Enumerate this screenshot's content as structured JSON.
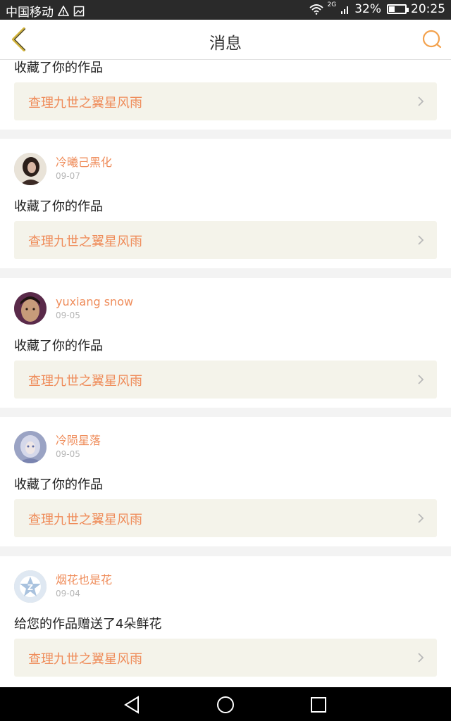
{
  "status_bar": {
    "carrier": "中国移动",
    "network": "2G",
    "battery": "32%",
    "time": "20:25",
    "battery_level": 0.32
  },
  "nav": {
    "title": "消息",
    "back_icon": "chevron-left-icon",
    "search_icon": "search-icon"
  },
  "colors": {
    "accent": "#ef8c5a",
    "back_arrow": "#d4b53a"
  },
  "messages": [
    {
      "action": "收藏了你的作品",
      "work_title": "查理九世之翼星风雨"
    },
    {
      "user": "冷曦己黑化",
      "date": "09-07",
      "action": "收藏了你的作品",
      "work_title": "查理九世之翼星风雨"
    },
    {
      "user": "yuxiang snow",
      "date": "09-05",
      "action": "收藏了你的作品",
      "work_title": "查理九世之翼星风雨"
    },
    {
      "user": "冷陨星落",
      "date": "09-05",
      "action": "收藏了你的作品",
      "work_title": "查理九世之翼星风雨"
    },
    {
      "user": "烟花也是花",
      "date": "09-04",
      "action": "给您的作品赠送了4朵鲜花",
      "work_title": "查理九世之翼星风雨"
    }
  ],
  "system_nav": {
    "back_icon": "triangle-back-icon",
    "home_icon": "circle-home-icon",
    "recents_icon": "square-recents-icon"
  }
}
